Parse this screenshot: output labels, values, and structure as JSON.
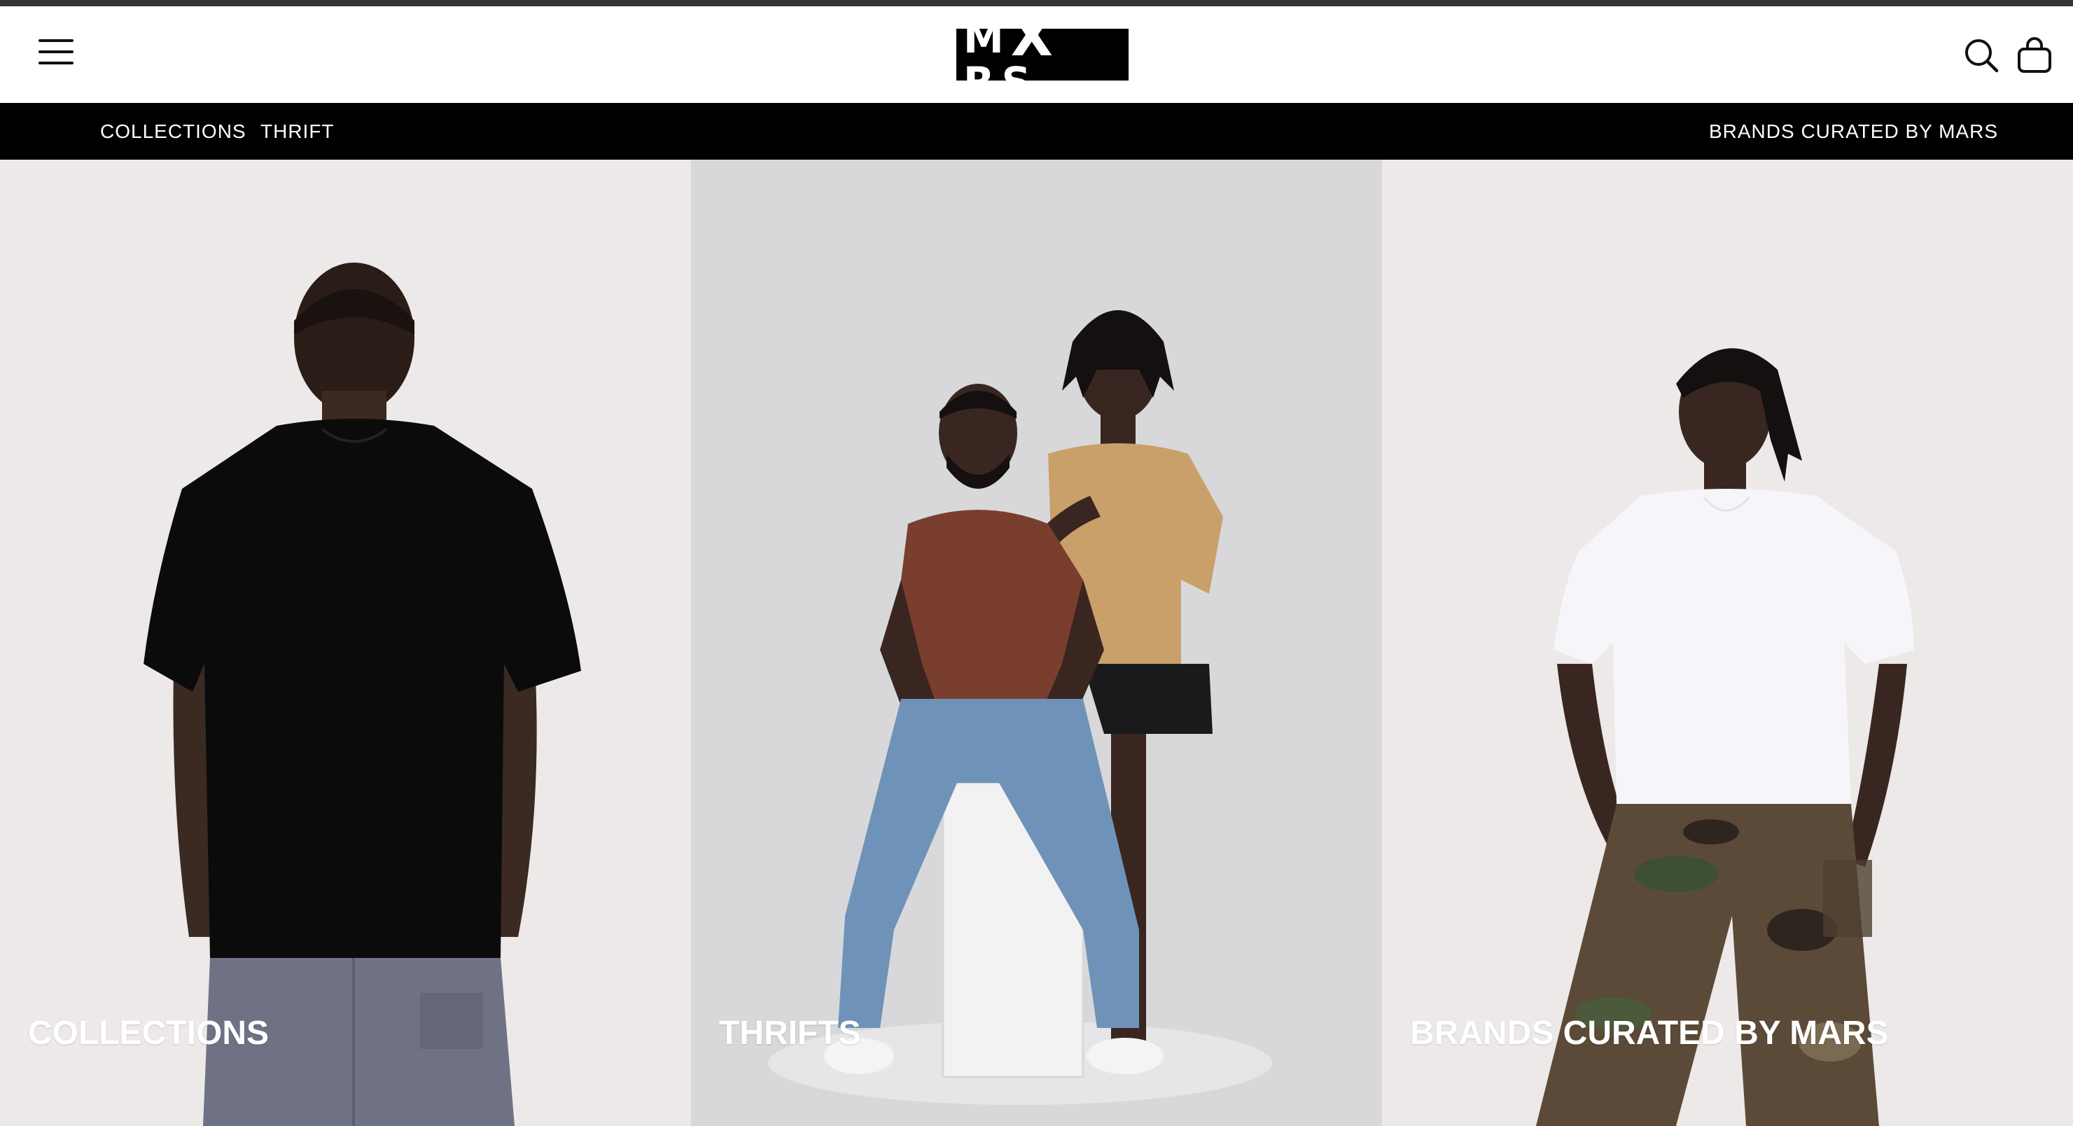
{
  "header": {
    "logo_text": "MXRS",
    "logo_left": "M",
    "logo_mid": "X",
    "logo_right": "RS",
    "menu_icon": "hamburger-menu-icon",
    "search_icon": "search-icon",
    "cart_icon": "shopping-bag-icon"
  },
  "subnav": {
    "left_items": [
      {
        "label": "COLLECTIONS"
      },
      {
        "label": "THRIFT"
      }
    ],
    "right_item": {
      "label": "BRANDS CURATED BY MARS"
    }
  },
  "panels": [
    {
      "label": "COLLECTIONS",
      "background": "#ece9e8"
    },
    {
      "label": "THRIFTS",
      "background": "#d8d8da"
    },
    {
      "label": "BRANDS CURATED BY MARS",
      "background": "#ece9e8"
    }
  ],
  "colors": {
    "nav_bar": "#000000",
    "top_rule": "#333333",
    "label_text": "#ffffff"
  }
}
